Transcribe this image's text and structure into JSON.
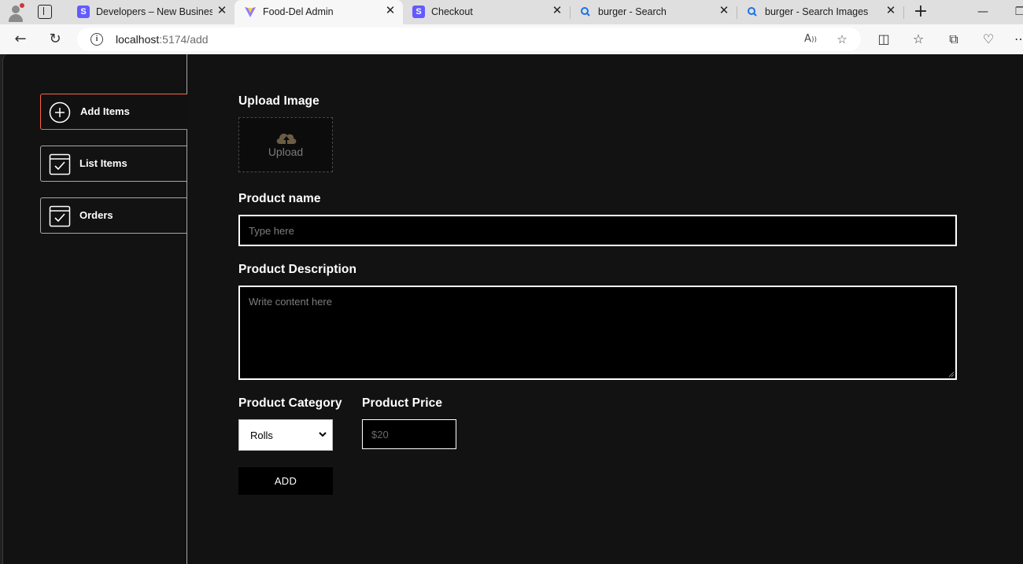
{
  "browser": {
    "tabs": [
      {
        "title": "Developers – New Business",
        "favicon": "stripe-icon"
      },
      {
        "title": "Food-Del Admin",
        "favicon": "vite-icon",
        "active": true
      },
      {
        "title": "Checkout",
        "favicon": "stripe-icon"
      },
      {
        "title": "burger - Search",
        "favicon": "search-icon"
      },
      {
        "title": "burger - Search Images",
        "favicon": "search-icon"
      }
    ],
    "url_host": "localhost",
    "url_path": ":5174/add"
  },
  "sidebar": {
    "items": [
      {
        "label": "Add Items",
        "icon": "add-circle-icon",
        "active": true
      },
      {
        "label": "List Items",
        "icon": "checklist-icon"
      },
      {
        "label": "Orders",
        "icon": "checklist-icon"
      }
    ]
  },
  "form": {
    "upload_label": "Upload Image",
    "upload_text": "Upload",
    "name_label": "Product name",
    "name_placeholder": "Type here",
    "description_label": "Product Description",
    "description_placeholder": "Write content here",
    "category_label": "Product Category",
    "category_value": "Rolls",
    "price_label": "Product Price",
    "price_placeholder": "$20",
    "submit_label": "ADD"
  },
  "colors": {
    "accent": "#ff6347",
    "background": "#121212"
  }
}
